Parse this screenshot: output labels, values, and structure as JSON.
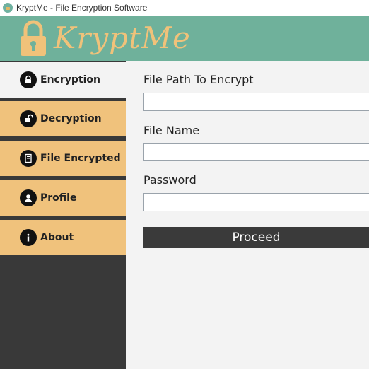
{
  "window": {
    "title": "KryptMe - File Encryption Software",
    "icon": "lock-app-icon"
  },
  "header": {
    "logo_text": "KryptMe",
    "logo_icon": "padlock-icon",
    "background": "#6fb19b",
    "accent": "#f0c27a"
  },
  "sidebar": {
    "background": "#393939",
    "item_color": "#f0c27c",
    "items": [
      {
        "label": "Encryption",
        "icon": "lock-icon",
        "active": true
      },
      {
        "label": "Decryption",
        "icon": "unlock-icon",
        "active": false
      },
      {
        "label": "File Encrypted",
        "icon": "document-icon",
        "active": false
      },
      {
        "label": "Profile",
        "icon": "user-icon",
        "active": false
      },
      {
        "label": "About",
        "icon": "info-icon",
        "active": false
      }
    ]
  },
  "form": {
    "file_path_label": "File Path To Encrypt",
    "file_path_value": "",
    "file_name_label": "File Name",
    "file_name_value": "",
    "password_label": "Password",
    "password_value": "",
    "proceed_label": "Proceed"
  }
}
